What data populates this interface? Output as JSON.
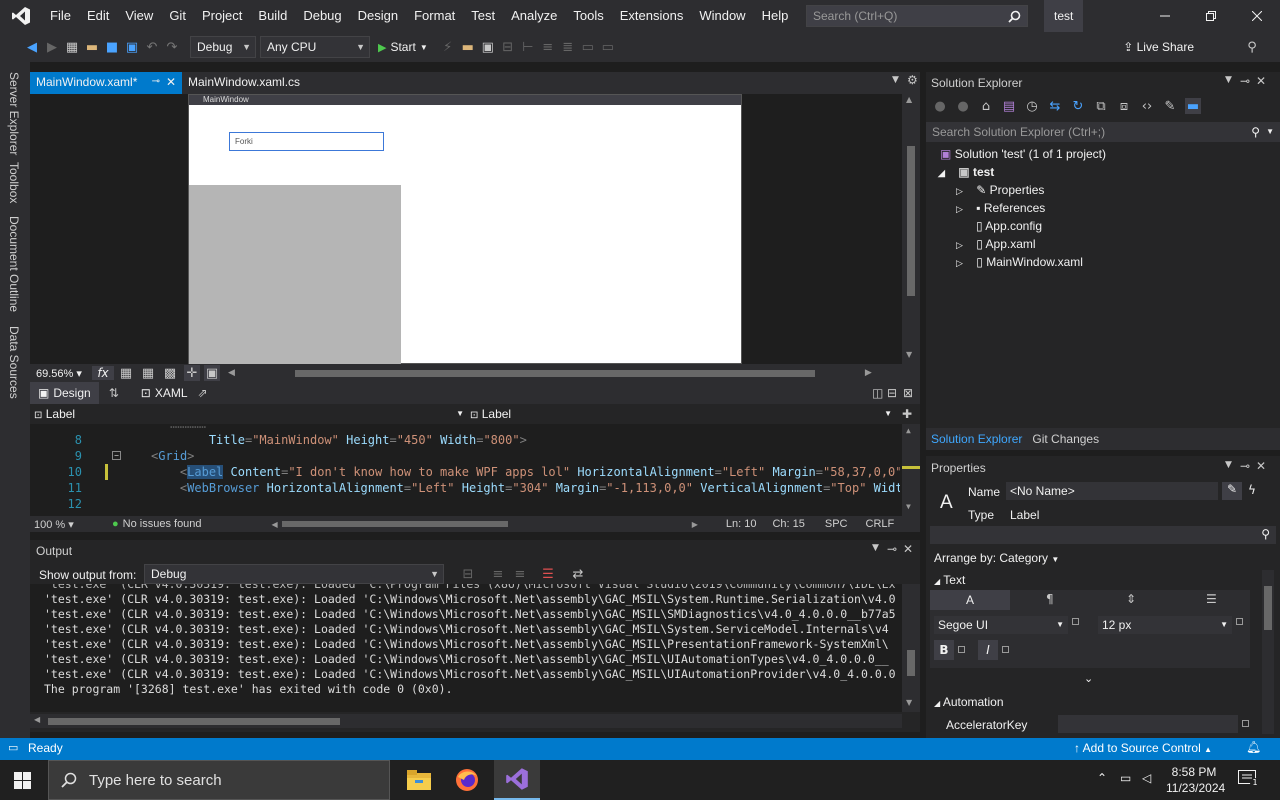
{
  "menubar": {
    "items": [
      "File",
      "Edit",
      "View",
      "Git",
      "Project",
      "Build",
      "Debug",
      "Design",
      "Format",
      "Test",
      "Analyze",
      "Tools",
      "Extensions",
      "Window",
      "Help"
    ],
    "search_placeholder": "Search (Ctrl+Q)",
    "solution_name": "test"
  },
  "toolbar": {
    "config": "Debug",
    "platform": "Any CPU",
    "start_label": "Start",
    "live_share": "Live Share"
  },
  "left_strip": [
    "Server Explorer",
    "Toolbox",
    "Document Outline",
    "Data Sources"
  ],
  "doc_tabs": [
    {
      "label": "MainWindow.xaml*",
      "active": true
    },
    {
      "label": "MainWindow.xaml.cs",
      "active": false
    }
  ],
  "designer": {
    "window_title": "MainWindow",
    "label_content": "Forki",
    "zoom": "69.56%",
    "fx": "fx"
  },
  "split": {
    "design_tab": "Design",
    "xaml_tab": "XAML"
  },
  "navbar": {
    "left": "Label",
    "right": "Label"
  },
  "code_lines": [
    {
      "n": "8",
      "indent": "            ",
      "parts": [
        [
          "attr",
          "Title"
        ],
        [
          "pun",
          "="
        ],
        [
          "aval",
          "\"MainWindow\""
        ],
        [
          "pun",
          " "
        ],
        [
          "attr",
          "Height"
        ],
        [
          "pun",
          "="
        ],
        [
          "aval",
          "\"450\""
        ],
        [
          "pun",
          " "
        ],
        [
          "attr",
          "Width"
        ],
        [
          "pun",
          "="
        ],
        [
          "aval",
          "\"800\""
        ],
        [
          "pun",
          ">"
        ]
      ]
    },
    {
      "n": "9",
      "indent": "    ",
      "parts": [
        [
          "pun",
          "<"
        ],
        [
          "tag",
          "Grid"
        ],
        [
          "pun",
          ">"
        ]
      ]
    },
    {
      "n": "10",
      "indent": "        ",
      "parts": [
        [
          "pun",
          "<"
        ],
        [
          "tag",
          "Label"
        ],
        [
          "pun",
          " "
        ],
        [
          "attr",
          "Content"
        ],
        [
          "pun",
          "="
        ],
        [
          "aval",
          "\"I don't know how to make WPF apps lol\""
        ],
        [
          "pun",
          " "
        ],
        [
          "attr",
          "HorizontalAlignment"
        ],
        [
          "pun",
          "="
        ],
        [
          "aval",
          "\"Left\""
        ],
        [
          "pun",
          " "
        ],
        [
          "attr",
          "Margin"
        ],
        [
          "pun",
          "="
        ],
        [
          "aval",
          "\"58,37,0,0\""
        ],
        [
          "pun",
          " "
        ],
        [
          "attr",
          "Ve"
        ]
      ]
    },
    {
      "n": "11",
      "indent": "        ",
      "parts": [
        [
          "pun",
          "<"
        ],
        [
          "tag",
          "WebBrowser"
        ],
        [
          "pun",
          " "
        ],
        [
          "attr",
          "HorizontalAlignment"
        ],
        [
          "pun",
          "="
        ],
        [
          "aval",
          "\"Left\""
        ],
        [
          "pun",
          " "
        ],
        [
          "attr",
          "Height"
        ],
        [
          "pun",
          "="
        ],
        [
          "aval",
          "\"304\""
        ],
        [
          "pun",
          " "
        ],
        [
          "attr",
          "Margin"
        ],
        [
          "pun",
          "="
        ],
        [
          "aval",
          "\"-1,113,0,0\""
        ],
        [
          "pun",
          " "
        ],
        [
          "attr",
          "VerticalAlignment"
        ],
        [
          "pun",
          "="
        ],
        [
          "aval",
          "\"Top\""
        ],
        [
          "pun",
          " "
        ],
        [
          "attr",
          "Width"
        ],
        [
          "pun",
          "=\""
        ]
      ]
    },
    {
      "n": "12",
      "indent": "",
      "parts": []
    }
  ],
  "editor_status": {
    "zoom": "100 %",
    "issues": "No issues found",
    "ln": "Ln: 10",
    "ch": "Ch: 15",
    "spc": "SPC",
    "crlf": "CRLF"
  },
  "output": {
    "title": "Output",
    "show_from_label": "Show output from:",
    "source": "Debug",
    "lines": [
      "'test.exe' (CLR v4.0.30319: test.exe): Loaded 'C:\\Windows\\Microsoft.Net\\assembly\\GAC_MSIL\\System.Runtime.Serialization\\v4.0",
      "'test.exe' (CLR v4.0.30319: test.exe): Loaded 'C:\\Windows\\Microsoft.Net\\assembly\\GAC_MSIL\\SMDiagnostics\\v4.0_4.0.0.0__b77a5",
      "'test.exe' (CLR v4.0.30319: test.exe): Loaded 'C:\\Windows\\Microsoft.Net\\assembly\\GAC_MSIL\\System.ServiceModel.Internals\\v4",
      "'test.exe' (CLR v4.0.30319: test.exe): Loaded 'C:\\Windows\\Microsoft.Net\\assembly\\GAC_MSIL\\PresentationFramework-SystemXml\\",
      "'test.exe' (CLR v4.0.30319: test.exe): Loaded 'C:\\Windows\\Microsoft.Net\\assembly\\GAC_MSIL\\UIAutomationTypes\\v4.0_4.0.0.0__",
      "'test.exe' (CLR v4.0.30319: test.exe): Loaded 'C:\\Windows\\Microsoft.Net\\assembly\\GAC_MSIL\\UIAutomationProvider\\v4.0_4.0.0.0",
      "The program '[3268] test.exe' has exited with code 0 (0x0)."
    ]
  },
  "solution_explorer": {
    "title": "Solution Explorer",
    "search_placeholder": "Search Solution Explorer (Ctrl+;)",
    "solution": "Solution 'test' (1 of 1 project)",
    "project": "test",
    "items": [
      "Properties",
      "References",
      "App.config",
      "App.xaml",
      "MainWindow.xaml"
    ],
    "tabs": [
      "Solution Explorer",
      "Git Changes"
    ]
  },
  "properties": {
    "title": "Properties",
    "name_label": "Name",
    "name_value": "<No Name>",
    "type_label": "Type",
    "type_value": "Label",
    "arrange": "Arrange by: Category",
    "text_section": "Text",
    "font_family": "Segoe UI",
    "font_size": "12 px",
    "bold": "B",
    "italic": "I",
    "automation_section": "Automation",
    "accelerator_key": "AcceleratorKey"
  },
  "statusbar": {
    "ready": "Ready",
    "source_control": "Add to Source Control"
  },
  "taskbar": {
    "search_placeholder": "Type here to search",
    "time": "8:58 PM",
    "date": "11/23/2024"
  }
}
